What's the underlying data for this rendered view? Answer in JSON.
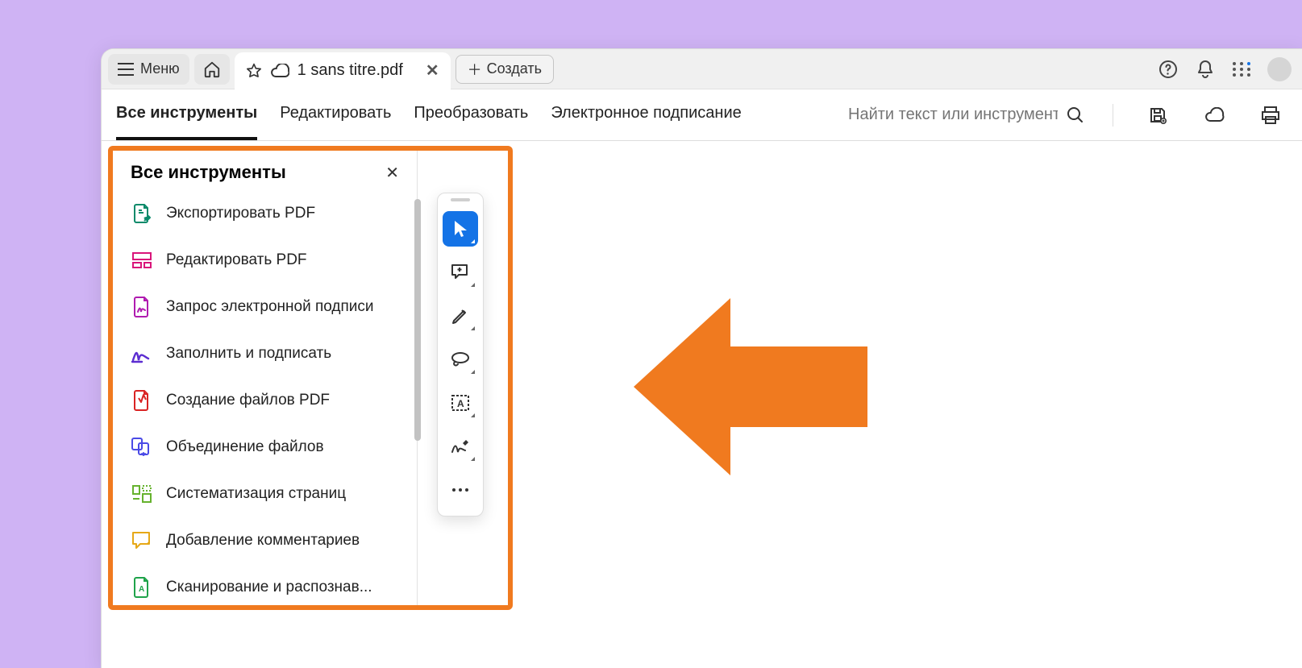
{
  "titlebar": {
    "menu_label": "Меню",
    "tab_title": "1 sans titre.pdf",
    "create_label": "Создать"
  },
  "menubar": {
    "items": [
      "Все инструменты",
      "Редактировать",
      "Преобразовать",
      "Электронное подписание"
    ],
    "search_placeholder": "Найти текст или инструмент"
  },
  "panel": {
    "title": "Все инструменты",
    "items": [
      {
        "label": "Экспортировать PDF",
        "icon": "export-pdf",
        "color": "#0a8a6a"
      },
      {
        "label": "Редактировать PDF",
        "icon": "edit-pdf",
        "color": "#d9157a"
      },
      {
        "label": "Запрос электронной подписи",
        "icon": "request-sign",
        "color": "#b01bb0"
      },
      {
        "label": "Заполнить и подписать",
        "icon": "fill-sign",
        "color": "#5c2dd1"
      },
      {
        "label": "Создание файлов PDF",
        "icon": "create-pdf",
        "color": "#d92323"
      },
      {
        "label": "Объединение файлов",
        "icon": "combine",
        "color": "#4a4ae6"
      },
      {
        "label": "Систематизация страниц",
        "icon": "organize",
        "color": "#66b22e"
      },
      {
        "label": "Добавление комментариев",
        "icon": "comment",
        "color": "#e6a817"
      },
      {
        "label": "Сканирование и распознав...",
        "icon": "scan",
        "color": "#1fa34a"
      }
    ]
  },
  "quickbar": {
    "items": [
      "select",
      "add-note",
      "draw",
      "lasso",
      "text-box",
      "sign",
      "more"
    ]
  }
}
